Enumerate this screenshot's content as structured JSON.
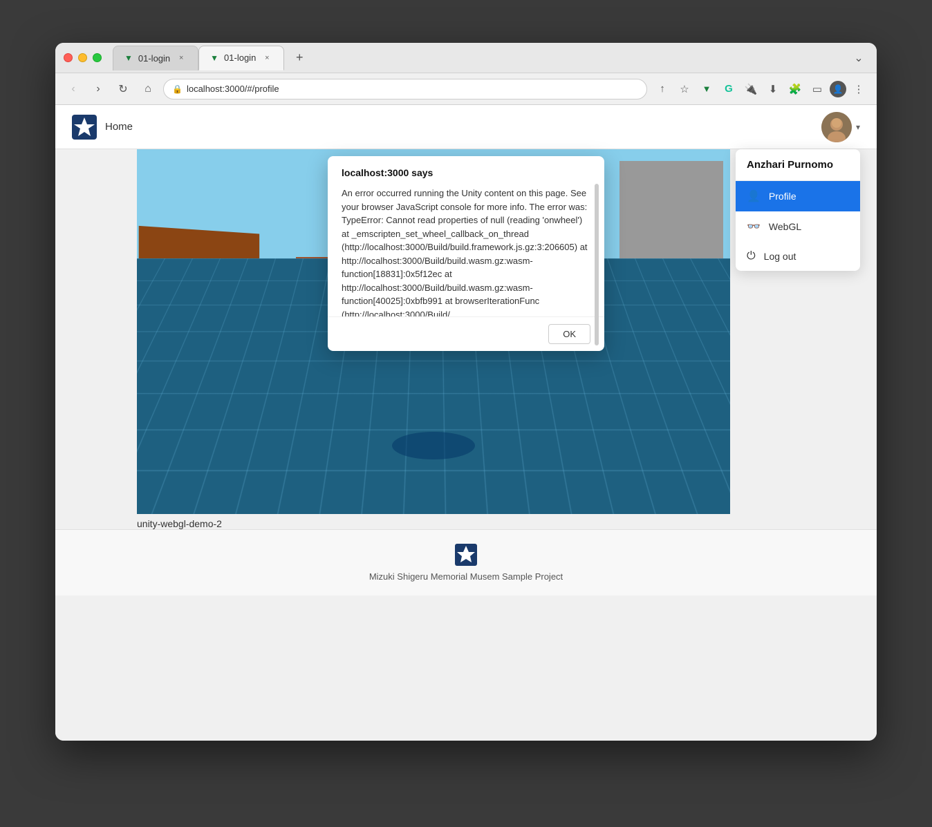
{
  "window": {
    "title": "Browser Window"
  },
  "tabs": [
    {
      "id": "tab1",
      "label": "01-login",
      "active": false,
      "favicon": "▼"
    },
    {
      "id": "tab2",
      "label": "01-login",
      "active": true,
      "favicon": "▼"
    }
  ],
  "addressbar": {
    "url": "localhost:3000/#/profile",
    "lock_icon": "🔒"
  },
  "header": {
    "nav_home": "Home"
  },
  "user": {
    "name": "Anzhari Purnomo"
  },
  "dropdown": {
    "profile_label": "Profile",
    "webgl_label": "WebGL",
    "logout_label": "Log out"
  },
  "alert": {
    "title": "localhost:3000 says",
    "body": "An error occurred running the Unity content on this page. See your browser JavaScript console for more info. The error was: TypeError: Cannot read properties of null (reading 'onwheel') at _emscripten_set_wheel_callback_on_thread (http://localhost:3000/Build/build.framework.js.gz:3:206605)\n    at http://localhost:3000/Build/build.wasm.gz:wasm-function[18831]:0x5f12ec\n    at http://localhost:3000/Build/build.wasm.gz:wasm-function[40025]:0xbfb991\n    at browserIterationFunc (http://localhost:3000/Build/",
    "ok_button": "OK"
  },
  "canvas": {
    "label": "unity-webgl-demo-2"
  },
  "footer": {
    "text": "Mizuki Shigeru Memorial Musem Sample Project"
  }
}
